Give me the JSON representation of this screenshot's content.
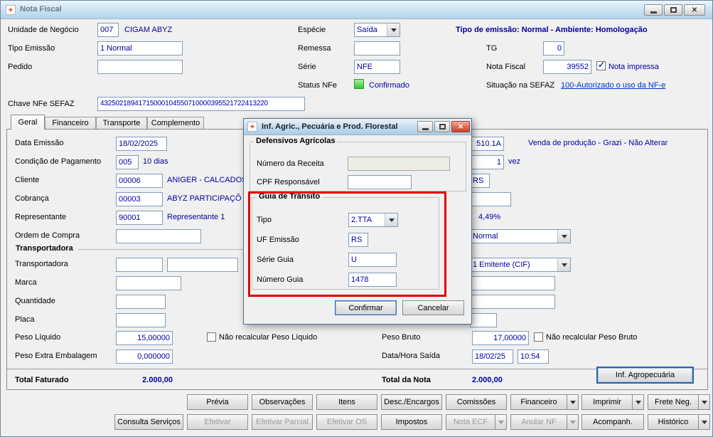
{
  "window": {
    "title": "Nota Fiscal"
  },
  "top": {
    "unidade": {
      "label": "Unidade de Negócio",
      "code": "007",
      "name": "CIGAM ABYZ"
    },
    "especie": {
      "label": "Espécie",
      "value": "Saída"
    },
    "banner": "Tipo de emissão: Normal - Ambiente: Homologação",
    "tipo_emissao": {
      "label": "Tipo Emissão",
      "value": "1 Normal"
    },
    "remessa": {
      "label": "Remessa",
      "value": ""
    },
    "tg": {
      "label": "TG",
      "value": "0"
    },
    "pedido": {
      "label": "Pedido",
      "value": ""
    },
    "serie": {
      "label": "Série",
      "value": "NFE"
    },
    "nota_fiscal": {
      "label": "Nota Fiscal",
      "value": "39552",
      "impressa_label": "Nota impressa"
    },
    "status_nfe": {
      "label": "Status NFe",
      "value": "Confirmado"
    },
    "sefaz": {
      "label": "Situação na SEFAZ",
      "link": "100-Autorizado o uso da NF-e"
    },
    "chave": {
      "label": "Chave NFe SEFAZ",
      "value": "43250218941715000104550710000395521722413220"
    }
  },
  "tabs": [
    "Geral",
    "Financeiro",
    "Transporte",
    "Complemento"
  ],
  "geral": {
    "data_emissao": {
      "label": "Data Emissão",
      "value": "18/02/2025"
    },
    "cond_pag": {
      "label": "Condição de Pagamento",
      "code": "005",
      "desc": "10 dias"
    },
    "cliente": {
      "label": "Cliente",
      "code": "00006",
      "desc": "ANIGER - CALCADOS"
    },
    "cobranca": {
      "label": "Cobrança",
      "code": "00003",
      "desc": "ABYZ PARTICIPAÇÕ"
    },
    "representante": {
      "label": "Representante",
      "code": "90001",
      "desc": "Representante 1"
    },
    "ordem_compra": {
      "label": "Ordem de Compra",
      "value": ""
    },
    "transportadora_group": "Transportadora",
    "transportadora": {
      "label": "Transportadora",
      "code": "",
      "desc": ""
    },
    "marca": {
      "label": "Marca",
      "value": ""
    },
    "quantidade": {
      "label": "Quantidade",
      "value": ""
    },
    "placa": {
      "label": "Placa",
      "value": ""
    },
    "peso_liquido": {
      "label": "Peso Líquido",
      "value": "15,00000",
      "check_label": "Não recalcular Peso Líquido"
    },
    "peso_extra": {
      "label": "Peso Extra Embalagem",
      "value": "0,000000"
    },
    "total_faturado": {
      "label": "Total Faturado",
      "value": "2.000,00"
    },
    "right": {
      "cfop_value": "510.1A",
      "cfop_desc": "Venda de produção - Grazi - Não Alterar",
      "vez_num": "1",
      "vez_label": "vez",
      "uf_value": "RS",
      "empty1": "",
      "percent": "4,49%",
      "combo1": "Normal",
      "combo2": "1 Emitente (CIF)",
      "empty2": "",
      "empty3": "",
      "empty4": "",
      "peso_bruto": {
        "label": "Peso Bruto",
        "value": "17,00000",
        "check_label": "Não recalcular Peso Bruto"
      },
      "saida": {
        "label": "Data/Hora Saída",
        "date": "18/02/25",
        "time": "10:54"
      },
      "total_nota": {
        "label": "Total da Nota",
        "value": "2.000,00"
      },
      "inf_agro": "Inf. Agropecuária"
    }
  },
  "dialog": {
    "title": "Inf. Agric., Pecuária e Prod. Florestal",
    "defensivos": {
      "group": "Defensivos Agrícolas",
      "receita": {
        "label": "Número da Receita",
        "value": ""
      },
      "cpf": {
        "label": "CPF Responsável",
        "value": ""
      }
    },
    "guia": {
      "group": "Guia de Trânsito",
      "tipo": {
        "label": "Tipo",
        "value": "2.TTA"
      },
      "uf": {
        "label": "UF Emissão",
        "value": "RS"
      },
      "serie": {
        "label": "Série Guia",
        "value": "U"
      },
      "numero": {
        "label": "Número Guia",
        "value": "1478"
      }
    },
    "confirm": "Confirmar",
    "cancel": "Cancelar"
  },
  "footer": {
    "row1": [
      {
        "label": "Prévia"
      },
      {
        "label": "Observações"
      },
      {
        "label": "Itens"
      },
      {
        "label": "Desc./Encargos"
      },
      {
        "label": "Comissões"
      },
      {
        "label": "Financeiro",
        "split": true
      },
      {
        "label": "Imprimir",
        "split": true
      },
      {
        "label": "Frete Neg.",
        "split": true
      }
    ],
    "row2": [
      {
        "label": "Consulta Serviços"
      },
      {
        "label": "Efetivar",
        "disabled": true
      },
      {
        "label": "Efetivar Parcial",
        "disabled": true
      },
      {
        "label": "Efetivar OS",
        "disabled": true
      },
      {
        "label": "Impostos"
      },
      {
        "label": "Nota ECF",
        "split": true,
        "disabled": true
      },
      {
        "label": "Anular NF",
        "split": true,
        "disabled": true
      },
      {
        "label": "Acompanh."
      },
      {
        "label": "Histórico",
        "split": true
      }
    ]
  },
  "colors": {
    "value_text": "#0000A0",
    "link": "#0033CC",
    "status_green": "#35C435",
    "annotation_red": "#DD0000"
  }
}
